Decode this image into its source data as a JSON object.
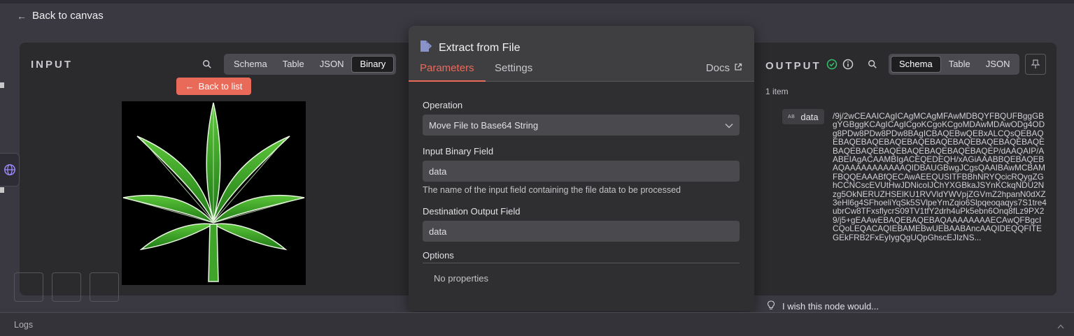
{
  "nav": {
    "back_label": "Back to canvas"
  },
  "input": {
    "title": "INPUT",
    "tabs": [
      "Schema",
      "Table",
      "JSON",
      "Binary"
    ],
    "active_tab": "Binary",
    "back_list_label": "Back to list"
  },
  "node": {
    "title": "Extract from File",
    "tabs": {
      "parameters": "Parameters",
      "settings": "Settings",
      "docs": "Docs"
    },
    "operation": {
      "label": "Operation",
      "value": "Move File to Base64 String"
    },
    "input_field": {
      "label": "Input Binary Field",
      "value": "data",
      "hint": "The name of the input field containing the file data to be processed"
    },
    "output_field": {
      "label": "Destination Output Field",
      "value": "data"
    },
    "options": {
      "label": "Options",
      "empty": "No properties"
    }
  },
  "output": {
    "title": "OUTPUT",
    "tabs": [
      "Schema",
      "Table",
      "JSON"
    ],
    "active_tab": "Schema",
    "item_count": "1 item",
    "field_type": "AB",
    "field_name": "data",
    "field_value": "/9j/2wCEAAICAgICAgMCAgMFAwMDBQYFBQUFBggGBgYGBggKCAgICAgICgoKCgoKCgoMDAwMDAwODg4ODg8PDw8PDw8PDw8BAgICBAQEBwQEBxALCQsQEBAQEBAQEBAQEBAQEBAQEBAQEBAQEBAQEBAQEBAQEBAQEBAQEBAQEBAQEBAQEBAQEBAQEP/dAAQAIP/AABEIAgACAAMBIgACEQEDEQH/xAGiAAABBQEBAQEBAQAAAAAAAAAAAQIDBAUGBwgJCgsQAAIBAwMCBAMFBQQEAAABfQECAwAEEQUSITFBBhNRYQcicRQygZGhCCNCscEVUtHwJDNicoIJChYXGBkaJSYnKCkqNDU2Nzg5OkNERUZHSElKU1RVVldYWVpjZGVmZ2hpanN0dXZ3eHl6g4SFhoeliYqSk5SVlpeYmZqio6Slpqeoqaqys7S1tre4ubrCw8TFxsflycrS09TV1tfY2drh4uPk5ebn6Onq8fLz9PX29/j5+gEAAwEBAQEBAQEBAQAAAAAAAAECAwQFBgcICQoLEQACAQIEBAMEBwUEBAABAncAAQIDEQQFITEGEkFRB2FxEyIygQgUQpGhscEJIzNS..."
  },
  "feedback": {
    "label": "I wish this node would..."
  },
  "logs": {
    "label": "Logs"
  }
}
